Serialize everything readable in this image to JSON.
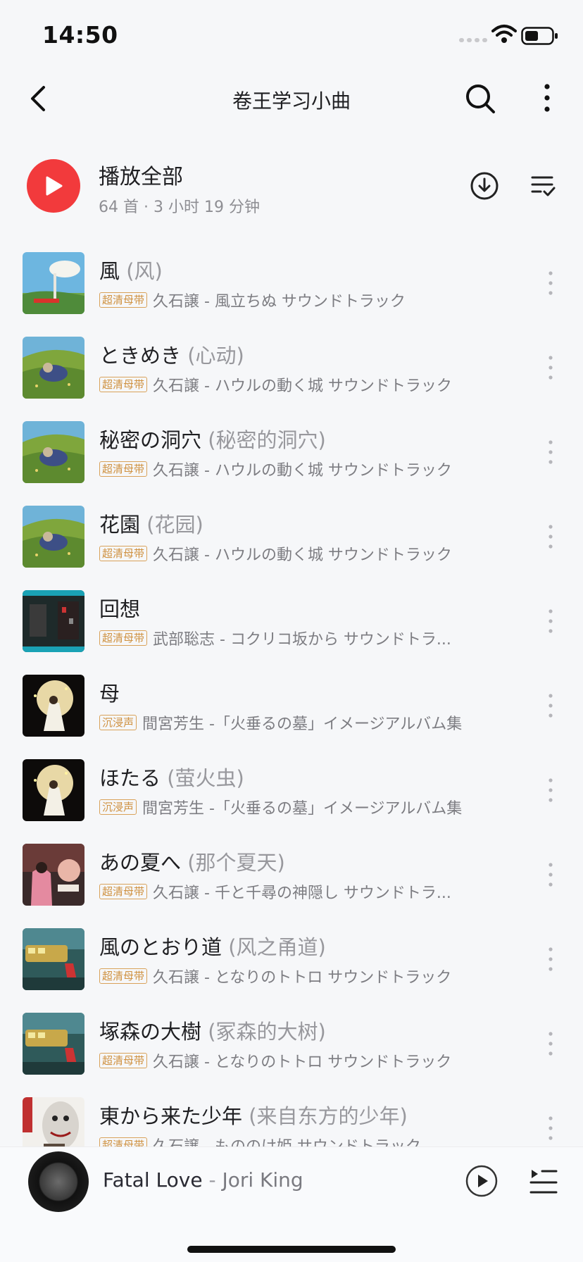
{
  "status_bar": {
    "time": "14:50"
  },
  "nav": {
    "title": "卷王学习小曲",
    "back_icon": "chevron-left-icon",
    "search_icon": "search-icon",
    "more_icon": "more-vertical-icon"
  },
  "header": {
    "play_all_label": "播放全部",
    "meta": "64 首 · 3 小时 19 分钟",
    "download_icon": "download-icon",
    "multiselect_icon": "multiselect-icon"
  },
  "songs": [
    {
      "title": "風",
      "alias": "(风)",
      "tag": "超清母带",
      "artist_album": "久石譲 - 風立ちぬ サウンドトラック",
      "cover": "sky"
    },
    {
      "title": "ときめき",
      "alias": "(心动)",
      "tag": "超清母带",
      "artist_album": "久石譲 - ハウルの動く城 サウンドトラック",
      "cover": "field"
    },
    {
      "title": "秘密の洞穴",
      "alias": "(秘密的洞穴)",
      "tag": "超清母带",
      "artist_album": "久石譲 - ハウルの動く城 サウンドトラック",
      "cover": "field"
    },
    {
      "title": "花園",
      "alias": "(花园)",
      "tag": "超清母带",
      "artist_album": "久石譲 - ハウルの動く城 サウンドトラック",
      "cover": "field"
    },
    {
      "title": "回想",
      "alias": "",
      "tag": "超清母带",
      "artist_album": "武部聡志 - コクリコ坂から サウンドトラ...",
      "cover": "dark-teal"
    },
    {
      "title": "母",
      "alias": "",
      "tag": "沉浸声",
      "artist_album": "間宮芳生 -「火垂るの墓」イメージアルバム集",
      "cover": "night"
    },
    {
      "title": "ほたる",
      "alias": "(萤火虫)",
      "tag": "沉浸声",
      "artist_album": "間宮芳生 -「火垂るの墓」イメージアルバム集",
      "cover": "night"
    },
    {
      "title": "あの夏へ",
      "alias": "(那个夏天)",
      "tag": "超清母带",
      "artist_album": "久石譲 - 千と千尋の神隠し サウンドトラ...",
      "cover": "spirited"
    },
    {
      "title": "風のとおり道",
      "alias": "(风之甬道)",
      "tag": "超清母带",
      "artist_album": "久石譲 - となりのトトロ サウンドトラック",
      "cover": "totoro"
    },
    {
      "title": "塚森の大樹",
      "alias": "(冢森的大树)",
      "tag": "超清母带",
      "artist_album": "久石譲 - となりのトトロ サウンドトラック",
      "cover": "totoro"
    },
    {
      "title": "東から来た少年",
      "alias": "(来自东方的少年)",
      "tag": "超清母带",
      "artist_album": "久石譲 - もののけ姫 サウンドトラック",
      "cover": "mononoke"
    }
  ],
  "mini_player": {
    "song": "Fatal Love",
    "separator": " - ",
    "artist": "Jori King",
    "play_icon": "play-circle-icon",
    "playlist_icon": "playlist-icon"
  },
  "colors": {
    "accent": "#f23a3c",
    "tag": "#cf9140",
    "muted": "#8e8e93"
  }
}
